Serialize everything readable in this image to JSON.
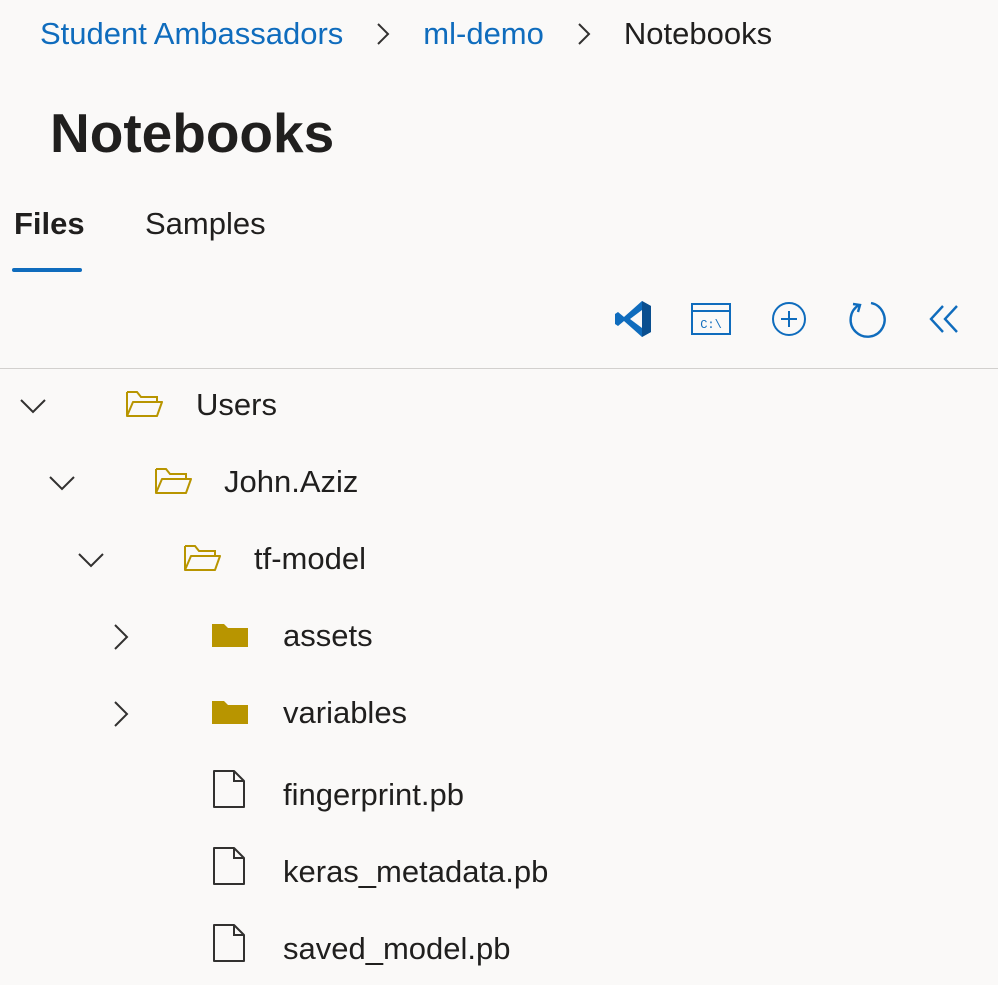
{
  "breadcrumb": {
    "items": [
      {
        "label": "Student Ambassadors"
      },
      {
        "label": "ml-demo"
      }
    ],
    "current": "Notebooks"
  },
  "page": {
    "title": "Notebooks"
  },
  "tabs": [
    {
      "label": "Files",
      "selected": true
    },
    {
      "label": "Samples",
      "selected": false
    }
  ],
  "toolbar": {
    "buttons": [
      {
        "icon": "vscode-icon"
      },
      {
        "icon": "terminal-icon"
      },
      {
        "icon": "add-circle-icon"
      },
      {
        "icon": "refresh-icon"
      },
      {
        "icon": "collapse-left-icon"
      }
    ]
  },
  "tree": {
    "rows": [
      {
        "label": "Users",
        "type": "folder",
        "expanded": true
      },
      {
        "label": "John.Aziz",
        "type": "folder",
        "expanded": true
      },
      {
        "label": "tf-model",
        "type": "folder",
        "expanded": true
      },
      {
        "label": "assets",
        "type": "folder",
        "expanded": false
      },
      {
        "label": "variables",
        "type": "folder",
        "expanded": false
      },
      {
        "label": "fingerprint.pb",
        "type": "file"
      },
      {
        "label": "keras_metadata.pb",
        "type": "file"
      },
      {
        "label": "saved_model.pb",
        "type": "file"
      }
    ]
  },
  "colors": {
    "accent": "#0f6cbd",
    "folder": "#b89500",
    "text": "#201f1e",
    "background": "#faf9f8"
  }
}
